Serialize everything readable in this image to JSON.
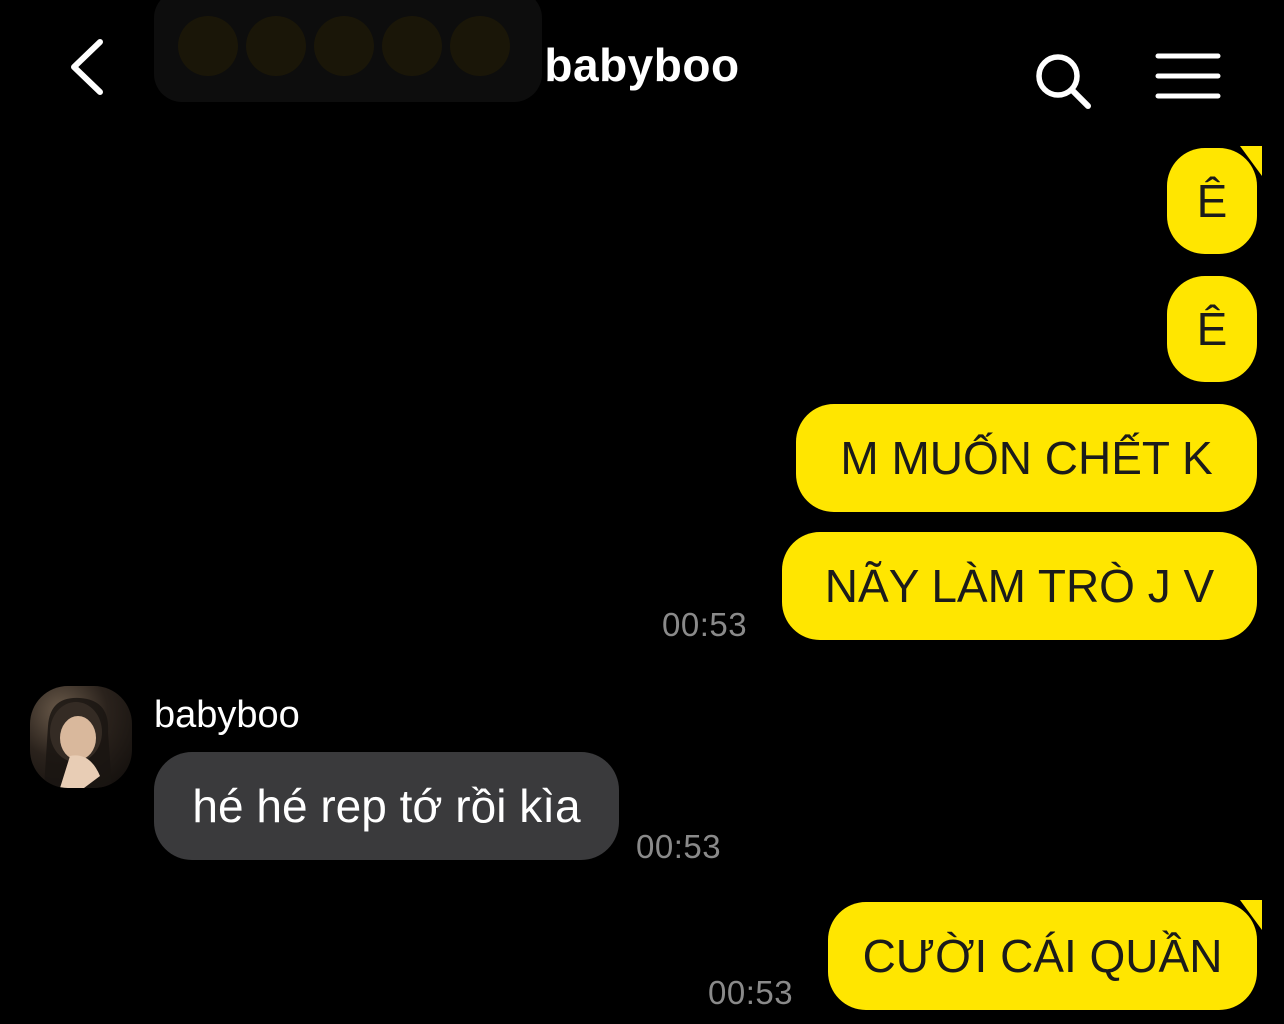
{
  "header": {
    "title": "babyboo",
    "back_icon": "chevron-left-icon",
    "search_icon": "search-icon",
    "menu_icon": "hamburger-menu-icon"
  },
  "colors": {
    "background": "#000000",
    "outgoing_bubble": "#FFE600",
    "incoming_bubble": "#3a3a3c",
    "timestamp": "#8a8a8a"
  },
  "messages": [
    {
      "direction": "outgoing",
      "text": "Ê"
    },
    {
      "direction": "outgoing",
      "text": "Ê"
    },
    {
      "direction": "outgoing",
      "text": "M MUỐN CHẾT K"
    },
    {
      "direction": "outgoing",
      "text": "NÃY LÀM TRÒ J V",
      "time": "00:53"
    },
    {
      "direction": "incoming",
      "sender": "babyboo",
      "text": "hé hé rep tớ rồi kìa",
      "time": "00:53"
    },
    {
      "direction": "outgoing",
      "text": "CƯỜI CÁI QUẦN",
      "time": "00:53"
    }
  ]
}
